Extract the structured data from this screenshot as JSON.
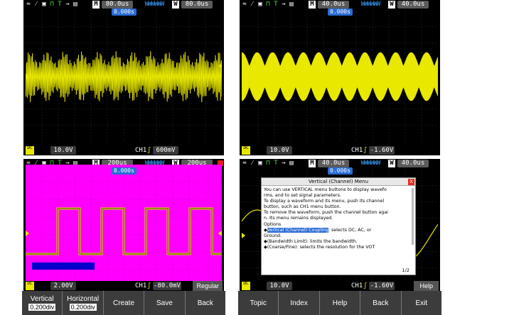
{
  "colors": {
    "trace": "#e8e800",
    "magenta_bg": "#ff00ff",
    "blue_accent": "#2a6cd6"
  },
  "panel1": {
    "top": {
      "letter_m": "M",
      "m_val": "80.0us",
      "letter_w": "W",
      "w_val": "80.0us",
      "trig_pos": "0.000s"
    },
    "bottom": {
      "volts": "10.0V",
      "ch": "CH1",
      "trig_level": "600mV"
    }
  },
  "panel2": {
    "top": {
      "letter_m": "M",
      "m_val": "40.0us",
      "letter_w": "W",
      "w_val": "40.0us",
      "trig_pos": "0.000s"
    },
    "bottom": {
      "volts": "10.0V",
      "ch": "CH1",
      "trig_level": "-1.60V"
    }
  },
  "panel3": {
    "top": {
      "letter_m": "M",
      "m_val": "200us",
      "letter_w": "W",
      "w_val": "200us",
      "trig_pos": "0.000s"
    },
    "bottom": {
      "volts": "2.00V",
      "ch": "CH1",
      "trig_level": "-80.0mV",
      "mode": "Regular"
    },
    "softkeys": [
      {
        "label": "Vertical",
        "value": "0.200div"
      },
      {
        "label": "Horizontal",
        "value": "0.200div"
      },
      {
        "label": "Create",
        "value": ""
      },
      {
        "label": "Save",
        "value": ""
      },
      {
        "label": "Back",
        "value": ""
      }
    ]
  },
  "panel4": {
    "top": {
      "letter_m": "M",
      "m_val": "40.0us",
      "letter_w": "W",
      "w_val": "40.0us",
      "trig_pos": "0.000s"
    },
    "bottom": {
      "volts": "10.0V",
      "ch": "CH1",
      "trig_level": "-1.60V",
      "mode": "Help"
    },
    "help": {
      "title": "Vertical (Channel) Menu",
      "close": "X",
      "lines": [
        "You can use VERTICAL menu buttons to display wavefo",
        "rms, and to set signal parameters.",
        "To display a waveform and its menu, push its channel",
        "button, such as CH1 menu button.",
        "To remove the waveform, push the channel button agai",
        "n. Its menu remains displayed.",
        "Options"
      ],
      "opt1_pre": "◆",
      "opt1_link": "Vertical (Channel) Coupling",
      "opt1_post": ": selects DC, AC, or",
      "opt1_cont": "Ground.",
      "opt2": "◆(Bandwidth Limit): limits the bandwidth.",
      "opt3": "◆(Coarse/Fine): selects the resolution for the VOT",
      "page": "1/2"
    },
    "softkeys": [
      {
        "label": "Topic"
      },
      {
        "label": "Index"
      },
      {
        "label": "Help"
      },
      {
        "label": "Back"
      },
      {
        "label": "Exit"
      }
    ]
  },
  "icons": [
    "trace-icon",
    "probe-icon",
    "save-icon",
    "run-icon",
    "trigger-icon",
    "disk-icon"
  ]
}
